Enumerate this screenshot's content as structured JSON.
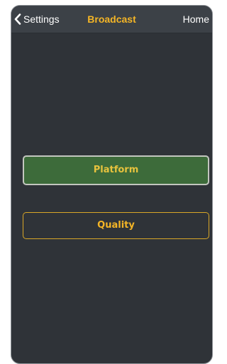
{
  "navbar": {
    "back_label": "Settings",
    "back_icon": "chevron-left-icon",
    "title": "Broadcast",
    "home_label": "Home"
  },
  "menu": {
    "platform_label": "Platform",
    "quality_label": "Quality"
  },
  "colors": {
    "background": "#2f3338",
    "navbar": "#3c4147",
    "accent": "#f4b526",
    "selected": "#3d6b3a"
  }
}
